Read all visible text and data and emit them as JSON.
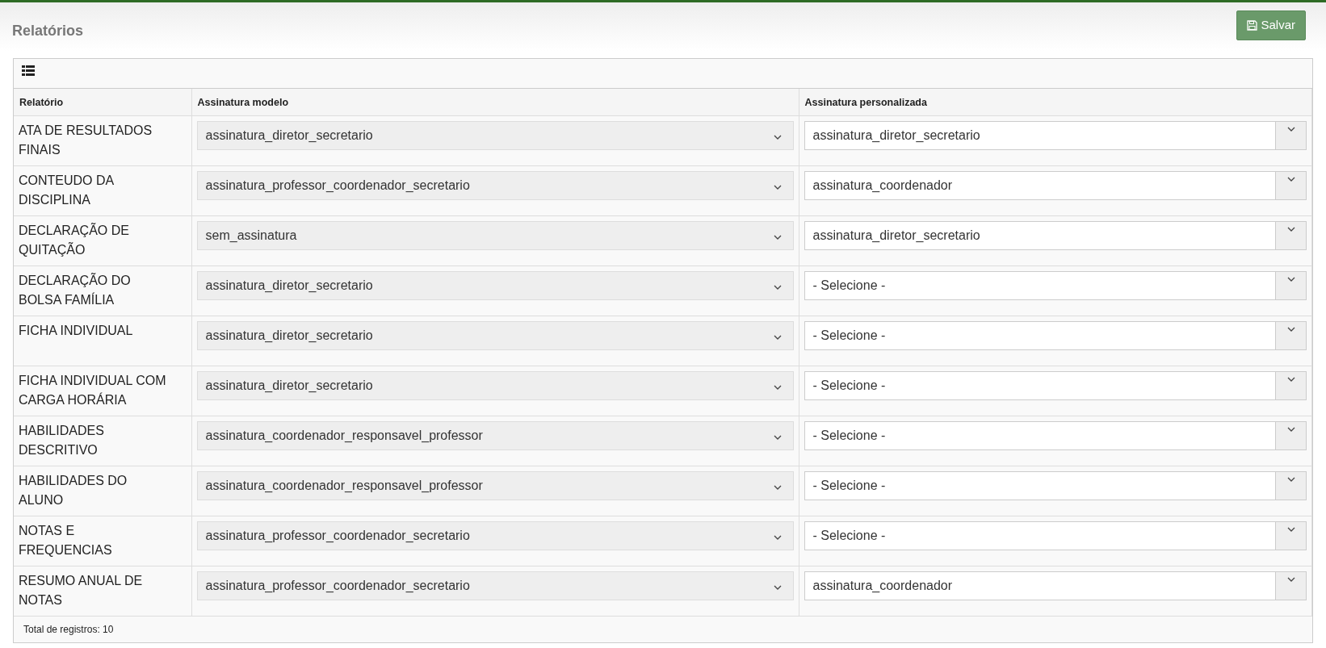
{
  "page_title": "Relatórios",
  "save_button": {
    "label": "Salvar"
  },
  "table": {
    "columns": [
      "Relatório",
      "Assinatura modelo",
      "Assinatura personalizada"
    ],
    "rows": [
      {
        "report": "ATA DE RESULTADOS FINAIS",
        "model": "assinatura_diretor_secretario",
        "custom": "assinatura_diretor_secretario"
      },
      {
        "report": "CONTEUDO DA DISCIPLINA",
        "model": "assinatura_professor_coordenador_secretario",
        "custom": "assinatura_coordenador"
      },
      {
        "report": "DECLARAÇÃO DE QUITAÇÃO",
        "model": "sem_assinatura",
        "custom": "assinatura_diretor_secretario"
      },
      {
        "report": "DECLARAÇÃO DO BOLSA FAMÍLIA",
        "model": "assinatura_diretor_secretario",
        "custom": "- Selecione -"
      },
      {
        "report": "FICHA INDIVIDUAL",
        "model": "assinatura_diretor_secretario",
        "custom": "- Selecione -"
      },
      {
        "report": "FICHA INDIVIDUAL COM CARGA HORÁRIA",
        "model": "assinatura_diretor_secretario",
        "custom": "- Selecione -"
      },
      {
        "report": "HABILIDADES DESCRITIVO",
        "model": "assinatura_coordenador_responsavel_professor",
        "custom": "- Selecione -"
      },
      {
        "report": "HABILIDADES DO ALUNO",
        "model": "assinatura_coordenador_responsavel_professor",
        "custom": "- Selecione -"
      },
      {
        "report": "NOTAS E FREQUENCIAS",
        "model": "assinatura_professor_coordenador_secretario",
        "custom": "- Selecione -"
      },
      {
        "report": "RESUMO ANUAL DE NOTAS",
        "model": "assinatura_professor_coordenador_secretario",
        "custom": "assinatura_coordenador"
      }
    ],
    "footer": "Total de registros: 10"
  }
}
